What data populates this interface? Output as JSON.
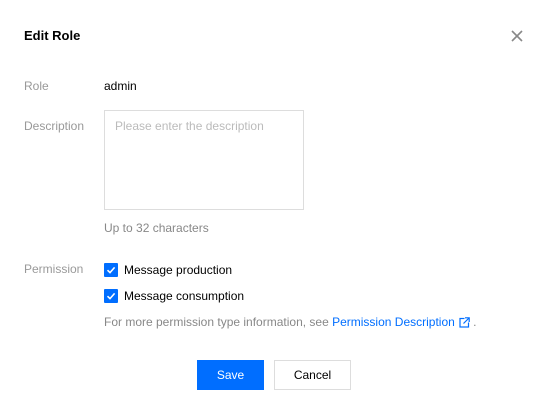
{
  "dialog": {
    "title": "Edit Role",
    "close_icon": "close-icon"
  },
  "form": {
    "role_label": "Role",
    "role_value": "admin",
    "description_label": "Description",
    "description_value": "",
    "description_placeholder": "Please enter the description",
    "description_hint": "Up to 32 characters",
    "permission_label": "Permission",
    "permissions": [
      {
        "label": "Message production",
        "checked": true
      },
      {
        "label": "Message consumption",
        "checked": true
      }
    ],
    "more_info_prefix": "For more permission type information, see ",
    "more_info_link": "Permission Description",
    "more_info_link_icon": "external-link-icon",
    "more_info_suffix": " ."
  },
  "footer": {
    "save_label": "Save",
    "cancel_label": "Cancel"
  },
  "colors": {
    "accent": "#006eff",
    "label": "#999999",
    "hint": "#888888",
    "border": "#dddddd"
  }
}
